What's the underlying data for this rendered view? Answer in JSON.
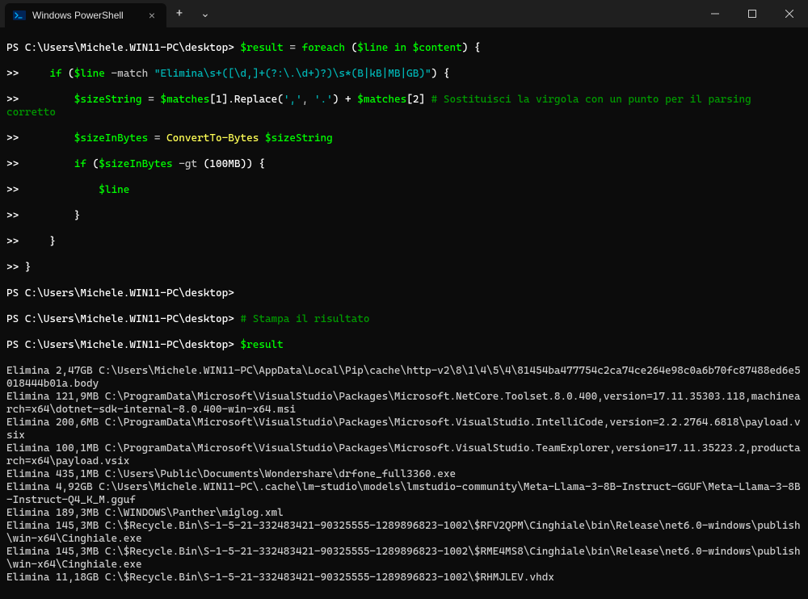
{
  "titlebar": {
    "tab_label": "Windows PowerShell",
    "tab_icon": "powershell-icon",
    "new_tab": "+",
    "dropdown": "⌄"
  },
  "prompt": "PS C:\\Users\\Michele.WIN11-PC\\desktop>",
  "cont": ">>",
  "script": {
    "l1_var": "$result",
    "l1_eq": " = ",
    "l1_foreach": "foreach",
    "l1_paren_open": " (",
    "l1_line": "$line",
    "l1_in": " in ",
    "l1_content": "$content",
    "l1_close": ") {",
    "l2_if": "if",
    "l2_open": " (",
    "l2_line": "$line",
    "l2_match": " -match ",
    "l2_regex": "\"Elimina\\s+([\\d,]+(?:\\.\\d+)?)\\s*(B|kB|MB|GB)\"",
    "l2_close": ") {",
    "l3_var": "$sizeString",
    "l3_eq": " = ",
    "l3_m1": "$matches",
    "l3_idx1": "[",
    "l3_one": "1",
    "l3_idx1c": "].",
    "l3_replace": "Replace",
    "l3_args_open": "(",
    "l3_arg1": "','",
    "l3_comma": ", ",
    "l3_arg2": "'.'",
    "l3_args_close": ") + ",
    "l3_m2": "$matches",
    "l3_idx2": "[",
    "l3_two": "2",
    "l3_idx2c": "] ",
    "l3_com": "# Sostituisci la virgola con un punto per il parsing corretto",
    "l4_var": "$sizeInBytes",
    "l4_eq": " = ",
    "l4_cmd": "ConvertTo-Bytes",
    "l4_arg": " $sizeString",
    "l5_if": "if",
    "l5_open": " (",
    "l5_var": "$sizeInBytes",
    "l5_gt": " -gt ",
    "l5_open2": "(",
    "l5_num": "100MB",
    "l5_close": ")) {",
    "l6_line": "$line",
    "l7_brace": "}",
    "l8_brace": "}",
    "l9_brace": "}"
  },
  "blank_prompt": "PS C:\\Users\\Michele.WIN11-PC\\desktop>",
  "comment_line": "# Stampa il risultato",
  "result_line": "$result",
  "output": [
    "Elimina 2,47GB C:\\Users\\Michele.WIN11-PC\\AppData\\Local\\Pip\\cache\\http-v2\\8\\1\\4\\5\\4\\81454ba477754c2ca74ce264e98c0a6b70fc87488ed6e5018444b01a.body",
    "Elimina 121,9MB C:\\ProgramData\\Microsoft\\VisualStudio\\Packages\\Microsoft.NetCore.Toolset.8.0.400,version=17.11.35303.118,machinearch=x64\\dotnet-sdk-internal-8.0.400-win-x64.msi",
    "Elimina 200,6MB C:\\ProgramData\\Microsoft\\VisualStudio\\Packages\\Microsoft.VisualStudio.IntelliCode,version=2.2.2764.6818\\payload.vsix",
    "Elimina 100,1MB C:\\ProgramData\\Microsoft\\VisualStudio\\Packages\\Microsoft.VisualStudio.TeamExplorer,version=17.11.35223.2,productarch=x64\\payload.vsix",
    "Elimina 435,1MB C:\\Users\\Public\\Documents\\Wondershare\\drfone_full3360.exe",
    "Elimina 4,92GB C:\\Users\\Michele.WIN11-PC\\.cache\\lm-studio\\models\\lmstudio-community\\Meta-Llama-3-8B-Instruct-GGUF\\Meta-Llama-3-8B-Instruct-Q4_K_M.gguf",
    "Elimina 189,3MB C:\\WINDOWS\\Panther\\miglog.xml",
    "Elimina 145,3MB C:\\$Recycle.Bin\\S-1-5-21-332483421-90325555-1289896823-1002\\$RFV2QPM\\Cinghiale\\bin\\Release\\net6.0-windows\\publish\\win-x64\\Cinghiale.exe",
    "Elimina 145,3MB C:\\$Recycle.Bin\\S-1-5-21-332483421-90325555-1289896823-1002\\$RME4MS8\\Cinghiale\\bin\\Release\\net6.0-windows\\publish\\win-x64\\Cinghiale.exe",
    "Elimina 11,18GB C:\\$Recycle.Bin\\S-1-5-21-332483421-90325555-1289896823-1002\\$RHMJLEV.vhdx"
  ]
}
